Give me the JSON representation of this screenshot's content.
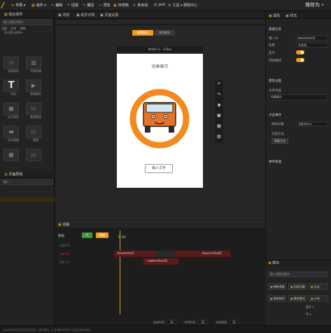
{
  "app": {
    "logo": "/",
    "save_label": "保存为"
  },
  "menu": [
    {
      "icon": "≡",
      "label": "布局"
    },
    {
      "icon": "▦",
      "label": "组件"
    },
    {
      "icon": "✎",
      "label": "编辑"
    },
    {
      "icon": "↶",
      "label": "回复"
    },
    {
      "icon": "↷",
      "label": "撤回"
    },
    {
      "icon": "▭",
      "label": "预览"
    },
    {
      "icon": "▣",
      "label": "存草稿"
    },
    {
      "icon": "✈",
      "label": "参考线"
    },
    {
      "icon": "▤",
      "label": "psd"
    },
    {
      "icon": "⚙",
      "label": "工具"
    },
    {
      "icon": "",
      "label": "帮助中心"
    }
  ],
  "left": {
    "title": "组合组件",
    "search_placeholder": "输入搜索关键字...",
    "filters": [
      "全部",
      "文本",
      "系统"
    ],
    "sort_label": "显示默认排序",
    "components": [
      {
        "icon": "▭",
        "label": "动画组件"
      },
      {
        "icon": "▥",
        "label": "列表容器"
      },
      {
        "icon": "T",
        "label": "文本"
      },
      {
        "icon": "▶",
        "label": "视频组件"
      },
      {
        "icon": "▦",
        "label": "交互组件"
      },
      {
        "icon": "▭",
        "label": "普通按钮"
      },
      {
        "icon": "▬",
        "label": "文本容器"
      },
      {
        "icon": "▭",
        "label": "视频"
      },
      {
        "icon": "▦",
        "label": ""
      },
      {
        "icon": "▭",
        "label": ""
      }
    ],
    "layers_title": "页面层级",
    "layers_search": "输入..."
  },
  "center": {
    "tabs": [
      "场景",
      "组件详情",
      "页面设置"
    ],
    "mode_active": "编辑模式",
    "mode_inactive": "预览模式",
    "device": "Mobile S - 320px",
    "phone": {
      "title": "动画展示",
      "button_label": "输入文字"
    }
  },
  "right": {
    "tabs": [
      "属性",
      "样式"
    ],
    "section_basic": "基础信息",
    "id_label": "唯一id",
    "id_value": "block/text1k",
    "name_label": "名称",
    "name_value": "文本组",
    "show_label": "显示",
    "lock_label": "持续模式",
    "section_advanced": "属性设置",
    "text_content_label": "文字内容",
    "text_content_value": "动画展示",
    "section_events": "点击事件",
    "event_label": "目标对象",
    "event_value": "当前节点",
    "event_sub": "可选方法",
    "event_btn": "拓展方法",
    "section_manage": "事件管理"
  },
  "anim": {
    "title": "动画",
    "label": "图层",
    "btn_add": "+",
    "btn_play": "播放",
    "time": "0.12s",
    "tracks": [
      "动画001",
      "文本 01",
      "刷新 01"
    ],
    "clips": [
      "bounceIn2",
      "bounceOutZ",
      "rubberBand2"
    ],
    "footer": [
      {
        "label": "起始时间",
        "value": "10"
      },
      {
        "label": "持续时间",
        "value": "10"
      },
      {
        "label": "动画重复",
        "value": "10"
      }
    ]
  },
  "script": {
    "title": "脚本",
    "search_placeholder": "输入搜索关键字...",
    "buttons": [
      "刷新速度",
      "回退功能",
      "点击",
      "更新插件",
      "属性模式",
      "示例",
      "展开",
      "合"
    ]
  },
  "status": "本软件所有权归原开发所有, 同时建议, psd 模块仅供学习用途请勿商用"
}
